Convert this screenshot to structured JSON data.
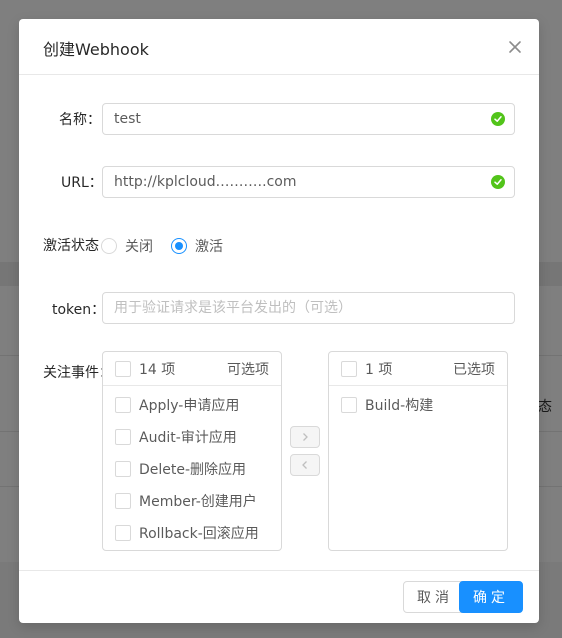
{
  "background": {
    "partial_text": "态"
  },
  "modal": {
    "title": "创建Webhook",
    "close_icon": "close-icon"
  },
  "form": {
    "name": {
      "label": "名称",
      "value": "test",
      "status_icon": "check-circle-icon"
    },
    "url": {
      "label": "URL",
      "value": "http://kplcloud.……….com",
      "status_icon": "check-circle-icon"
    },
    "status": {
      "label": "激活状态",
      "options": [
        {
          "label": "关闭",
          "checked": false
        },
        {
          "label": "激活",
          "checked": true
        }
      ]
    },
    "token": {
      "label": "token",
      "value": "",
      "placeholder": "用于验证请求是该平台发出的（可选）"
    },
    "events": {
      "label": "关注事件",
      "source": {
        "count_label": "14 项",
        "title": "可选项",
        "items": [
          {
            "label": "Apply-申请应用",
            "checked": false
          },
          {
            "label": "Audit-审计应用",
            "checked": false
          },
          {
            "label": "Delete-删除应用",
            "checked": false
          },
          {
            "label": "Member-创建用户",
            "checked": false
          },
          {
            "label": "Rollback-回滚应用",
            "checked": false
          }
        ]
      },
      "target": {
        "count_label": "1 项",
        "title": "已选项",
        "items": [
          {
            "label": "Build-构建",
            "checked": false
          }
        ]
      },
      "move_right_icon": "chevron-right-icon",
      "move_left_icon": "chevron-left-icon"
    }
  },
  "footer": {
    "cancel_label": "取消",
    "ok_label": "确定"
  },
  "colors": {
    "primary": "#1890ff",
    "success": "#52c41a",
    "border": "#d9d9d9",
    "overlay": "#7f7f7f"
  }
}
